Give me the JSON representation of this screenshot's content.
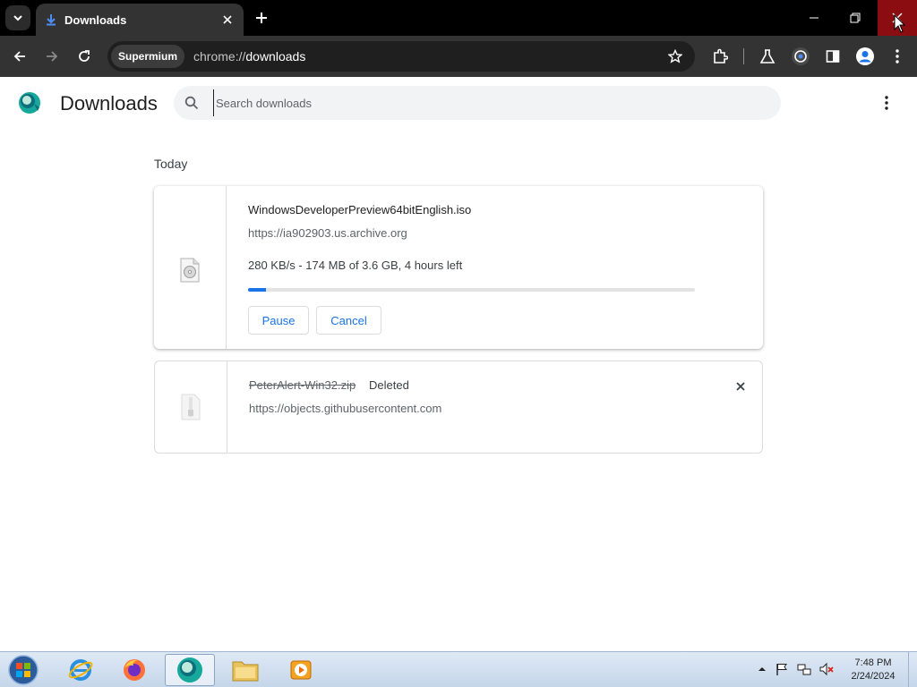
{
  "tab": {
    "title": "Downloads",
    "icon": "download-arrow-icon"
  },
  "omnibox": {
    "chip": "Supermium",
    "url_scheme": "chrome://",
    "url_host": "downloads"
  },
  "page": {
    "title": "Downloads",
    "search_placeholder": "Search downloads",
    "section_label": "Today"
  },
  "downloads": [
    {
      "filename": "WindowsDeveloperPreview64bitEnglish.iso",
      "source": "https://ia902903.us.archive.org",
      "status": "280 KB/s - 174 MB of 3.6 GB, 4 hours left",
      "progress": 0.04,
      "pause_label": "Pause",
      "cancel_label": "Cancel"
    },
    {
      "filename": "PeterAlert-Win32.zip",
      "state": "Deleted",
      "source": "https://objects.githubusercontent.com"
    }
  ],
  "taskbar": {
    "time": "7:48 PM",
    "date": "2/24/2024"
  },
  "colors": {
    "accent": "#1a73e8",
    "titlebar": "#000000",
    "toolbar": "#333333",
    "close_button": "#8b0d12"
  }
}
